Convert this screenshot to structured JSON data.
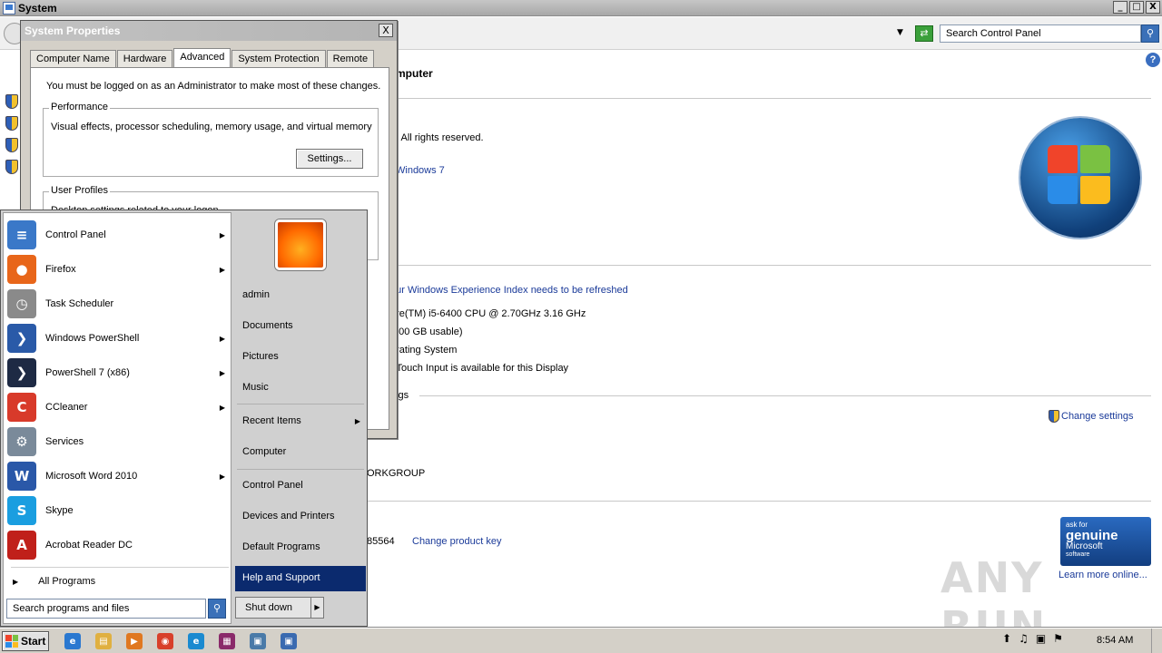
{
  "window": {
    "title": "System",
    "minimize": "_",
    "maximize": "□",
    "close": "X"
  },
  "address_bar": {
    "dropdown": "▼",
    "refresh": "⇄",
    "search_value": "Search Control Panel",
    "search_icon": "search-icon"
  },
  "main": {
    "heading_fragment": "mputer",
    "copyright": ".  All rights reserved.",
    "edition_link": "Windows 7",
    "experience_link": "our Windows Experience Index needs to be refreshed",
    "processor": "ore(TM) i5-6400 CPU @ 2.70GHz   3.16 GHz",
    "memory": "3.00 GB usable)",
    "system_type": "erating System",
    "pen_touch": "r Touch Input is available for this Display",
    "settings_section": "ings",
    "change_settings": "Change settings",
    "workgroup": "ORKGROUP",
    "product_id": "85564",
    "change_product_key": "Change product key",
    "genuine": {
      "line1": "ask for",
      "line2": "genuine",
      "line3": "Microsoft",
      "line4": "software"
    },
    "learn_more": "Learn more online...",
    "watermark": "ANY RUN"
  },
  "dialog": {
    "title": "System Properties",
    "close": "X",
    "tabs": [
      {
        "label": "Computer Name"
      },
      {
        "label": "Hardware"
      },
      {
        "label": "Advanced"
      },
      {
        "label": "System Protection"
      },
      {
        "label": "Remote"
      }
    ],
    "active_tab": "Advanced",
    "admin_note": "You must be logged on as an Administrator to make most of these changes.",
    "performance": {
      "label": "Performance",
      "desc": "Visual effects, processor scheduling, memory usage, and virtual memory",
      "button": "Settings..."
    },
    "user_profiles": {
      "label": "User Profiles",
      "desc": "Desktop settings related to your logon"
    }
  },
  "start_menu": {
    "programs": [
      {
        "label": "Control Panel",
        "submenu": true,
        "icon": "control-panel-icon",
        "color": "#3a78c8",
        "glyph": "≡"
      },
      {
        "label": "Firefox",
        "submenu": true,
        "icon": "firefox-icon",
        "color": "#e8661a",
        "glyph": "●"
      },
      {
        "label": "Task Scheduler",
        "submenu": false,
        "icon": "task-scheduler-icon",
        "color": "#8a8a8a",
        "glyph": "◷"
      },
      {
        "label": "Windows PowerShell",
        "submenu": true,
        "icon": "powershell-icon",
        "color": "#2a5aa8",
        "glyph": "❯"
      },
      {
        "label": "PowerShell 7 (x86)",
        "submenu": true,
        "icon": "powershell7-icon",
        "color": "#1e2a44",
        "glyph": "❯"
      },
      {
        "label": "CCleaner",
        "submenu": true,
        "icon": "ccleaner-icon",
        "color": "#d83a2a",
        "glyph": "C"
      },
      {
        "label": "Services",
        "submenu": false,
        "icon": "services-icon",
        "color": "#7a8a9a",
        "glyph": "⚙"
      },
      {
        "label": "Microsoft Word 2010",
        "submenu": true,
        "icon": "word-icon",
        "color": "#2a58a8",
        "glyph": "W"
      },
      {
        "label": "Skype",
        "submenu": false,
        "icon": "skype-icon",
        "color": "#1a9ee0",
        "glyph": "S"
      },
      {
        "label": "Acrobat Reader DC",
        "submenu": false,
        "icon": "acrobat-icon",
        "color": "#c0201a",
        "glyph": "A"
      }
    ],
    "all_programs": "All Programs",
    "all_programs_arrow": "▶",
    "search_placeholder": "Search programs and files",
    "right_items": [
      {
        "label": "admin",
        "submenu": false
      },
      {
        "label": "Documents",
        "submenu": false
      },
      {
        "label": "Pictures",
        "submenu": false
      },
      {
        "label": "Music",
        "submenu": false
      },
      {
        "label": "Recent Items",
        "submenu": true
      },
      {
        "label": "Computer",
        "submenu": false
      },
      {
        "label": "Control Panel",
        "submenu": false
      },
      {
        "label": "Devices and Printers",
        "submenu": false
      },
      {
        "label": "Default Programs",
        "submenu": false
      },
      {
        "label": "Help and Support",
        "submenu": false,
        "highlighted": true
      }
    ],
    "shutdown": "Shut down",
    "shutdown_arrow": "▶"
  },
  "taskbar": {
    "start": "Start",
    "pinned": [
      {
        "name": "internet-explorer-icon",
        "color": "#2a78d0",
        "glyph": "e"
      },
      {
        "name": "explorer-icon",
        "color": "#e0b040",
        "glyph": "▤"
      },
      {
        "name": "media-player-icon",
        "color": "#e07820",
        "glyph": "▶"
      },
      {
        "name": "chrome-icon",
        "color": "#d8402a",
        "glyph": "◉"
      },
      {
        "name": "edge-icon",
        "color": "#1a8ad0",
        "glyph": "e"
      },
      {
        "name": "winrar-icon",
        "color": "#8a2a6a",
        "glyph": "▦"
      },
      {
        "name": "remote-desktop-icon",
        "color": "#4a7aa8",
        "glyph": "▣"
      },
      {
        "name": "system-icon",
        "color": "#3a6ab0",
        "glyph": "▣"
      }
    ],
    "tray_icons": [
      "⬆",
      "♫",
      "▣",
      "⚑"
    ],
    "clock": "8:54 AM"
  }
}
